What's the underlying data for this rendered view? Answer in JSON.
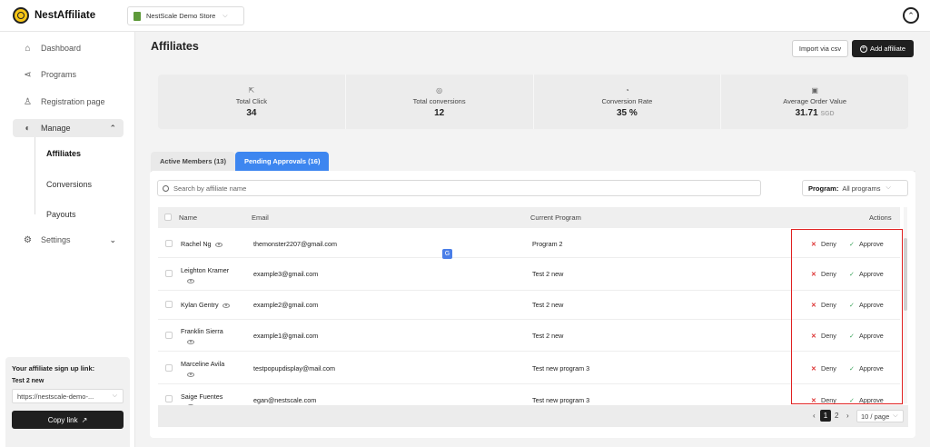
{
  "topbar": {
    "brand": "NestAffiliate",
    "store": "NestScale Demo Store"
  },
  "sidebar": {
    "items": [
      {
        "label": "Dashboard",
        "icon": "home-icon"
      },
      {
        "label": "Programs",
        "icon": "share-icon"
      },
      {
        "label": "Registration page",
        "icon": "user-plus-icon"
      },
      {
        "label": "Manage",
        "icon": "toggle-icon"
      },
      {
        "label": "Settings",
        "icon": "gear-icon"
      }
    ],
    "sub_items": [
      "Affiliates",
      "Conversions",
      "Payouts"
    ],
    "signup": {
      "title": "Your affiliate sign up link:",
      "program": "Test 2 new",
      "link": "https://nestscale-demo-...",
      "copy_label": "Copy link"
    }
  },
  "header": {
    "title": "Affiliates",
    "import_label": "Import via csv",
    "add_label": "Add affiliate"
  },
  "stats": [
    {
      "label": "Total Click",
      "value": "34",
      "unit": "",
      "icon": "cursor-icon"
    },
    {
      "label": "Total conversions",
      "value": "12",
      "unit": "",
      "icon": "target-icon"
    },
    {
      "label": "Conversion Rate",
      "value": "35 %",
      "unit": "",
      "icon": "pie-icon"
    },
    {
      "label": "Average Order Value",
      "value": "31.71",
      "unit": "SGD",
      "icon": "bag-icon"
    }
  ],
  "tabs": [
    {
      "label": "Active Members (13)",
      "active": false
    },
    {
      "label": "Pending Approvals (16)",
      "active": true
    }
  ],
  "search": {
    "placeholder": "Search by affiliate name"
  },
  "program_filter": {
    "label": "Program:",
    "value": "All programs"
  },
  "table": {
    "columns": [
      "Name",
      "Email",
      "Current Program",
      "Actions"
    ],
    "deny_label": "Deny",
    "approve_label": "Approve",
    "rows": [
      {
        "name": "Rachel Ng",
        "email": "themonster2207@gmail.com",
        "program": "Program 2"
      },
      {
        "name": "Leighton Kramer",
        "email": "example3@gmail.com",
        "program": "Test 2 new"
      },
      {
        "name": "Kylan Gentry",
        "email": "example2@gmail.com",
        "program": "Test 2 new"
      },
      {
        "name": "Franklin Sierra",
        "email": "example1@gmail.com",
        "program": "Test 2 new"
      },
      {
        "name": "Marceline Avila",
        "email": "testpopupdisplay@mail.com",
        "program": "Test new program 3"
      },
      {
        "name": "Saige Fuentes",
        "email": "egan@nestscale.com",
        "program": "Test new program 3"
      }
    ]
  },
  "pagination": {
    "current": "1",
    "next_page": "2",
    "page_size": "10 / page"
  },
  "colors": {
    "accent": "#3d86f0",
    "dark": "#1f1f1f",
    "deny": "#d33333",
    "approve": "#3aa35a",
    "highlight": "#e02020"
  }
}
